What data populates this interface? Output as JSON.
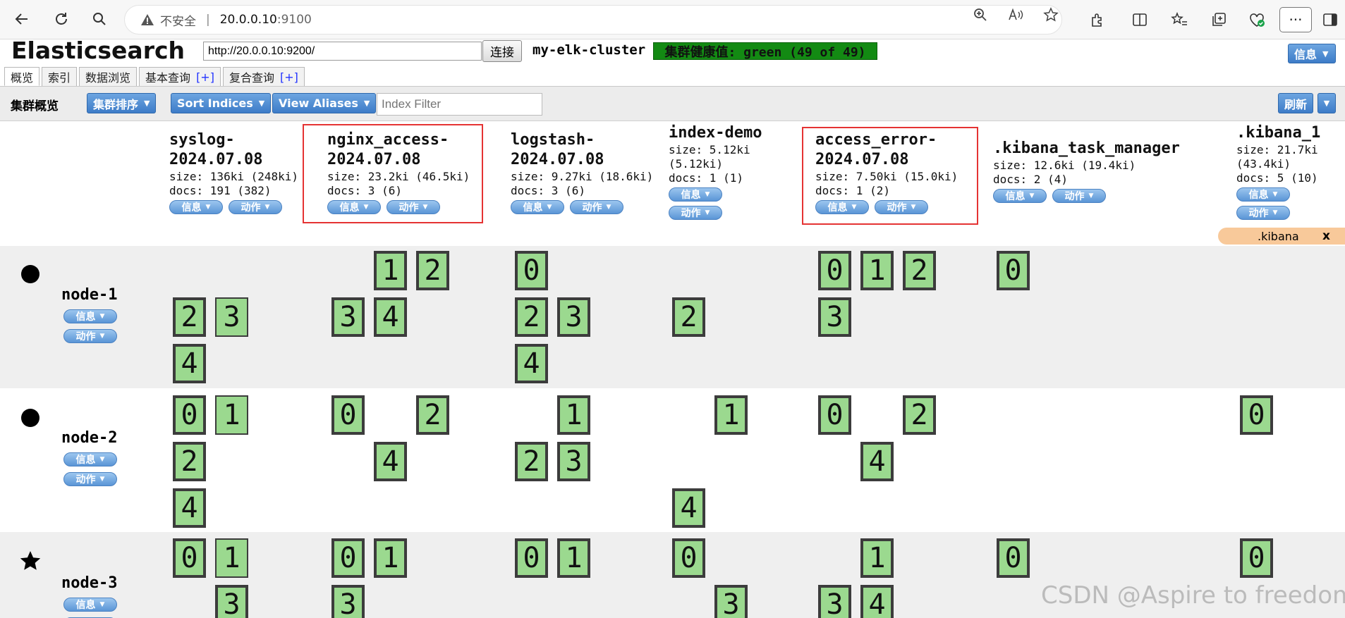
{
  "browser": {
    "insecure_label": "不安全",
    "address_sep": "|",
    "url_host": "20.0.0.10",
    "url_port": ":9100"
  },
  "app": {
    "title": "Elasticsearch",
    "connection_url": "http://20.0.0.10:9200/",
    "connect_label": "连接",
    "cluster_name": "my-elk-cluster",
    "health": "集群健康值: green (49 of 49)",
    "health_color": "#138a13",
    "info_label": "信息"
  },
  "tabs": [
    {
      "label": "概览",
      "plus": ""
    },
    {
      "label": "索引",
      "plus": ""
    },
    {
      "label": "数据浏览",
      "plus": ""
    },
    {
      "label": "基本查询",
      "plus": "[+]"
    },
    {
      "label": "复合查询",
      "plus": "[+]"
    }
  ],
  "toolbar": {
    "title": "集群概览",
    "sort_cluster": "集群排序",
    "sort_indices": "Sort Indices",
    "view_aliases": "View Aliases",
    "index_filter_placeholder": "Index Filter",
    "refresh": "刷新"
  },
  "pill_labels": {
    "info": "信息",
    "action": "动作"
  },
  "indices": [
    {
      "name": "syslog-\n2024.07.08",
      "meta": [
        "size: 136ki (248ki)",
        "docs: 191 (382)"
      ],
      "highlighted": false
    },
    {
      "name": "nginx_access-\n2024.07.08",
      "meta": [
        "size: 23.2ki (46.5ki)",
        "docs: 3 (6)"
      ],
      "highlighted": true
    },
    {
      "name": "logstash-\n2024.07.08",
      "meta": [
        "size: 9.27ki (18.6ki)",
        "docs: 3 (6)"
      ],
      "highlighted": false
    },
    {
      "name": "index-demo",
      "meta": [
        "size: 5.12ki",
        "(5.12ki)",
        "docs: 1 (1)"
      ],
      "highlighted": false
    },
    {
      "name": "access_error-\n2024.07.08",
      "meta": [
        "size: 7.50ki (15.0ki)",
        "docs: 1 (2)"
      ],
      "highlighted": true
    },
    {
      "name": ".kibana_task_manager",
      "meta": [
        "size: 12.6ki (19.4ki)",
        "docs: 2 (4)"
      ],
      "highlighted": false
    },
    {
      "name": ".kibana_1",
      "meta": [
        "size: 21.7ki",
        "(43.4ki)",
        "docs: 5 (10)"
      ],
      "highlighted": false
    }
  ],
  "alias": {
    "name": ".kibana",
    "close": "x"
  },
  "nodes": [
    {
      "name": "node-1",
      "icon": "circle-icon"
    },
    {
      "name": "node-2",
      "icon": "circle-icon"
    },
    {
      "name": "node-3",
      "icon": "star-icon"
    }
  ],
  "shards": {
    "node-1": {
      "nginx_access-2024.07.08": [
        "1",
        "2",
        "3",
        "4"
      ],
      "logstash-2024.07.08": [
        "0",
        "2",
        "3",
        "4"
      ],
      "syslog-2024.07.08": [
        "2",
        "3",
        "4"
      ],
      "index-demo": [
        "2"
      ],
      "access_error-2024.07.08": [
        "0",
        "1",
        "2",
        "3"
      ],
      ".kibana_task_manager": [
        "0"
      ]
    },
    "node-2": {
      "syslog-2024.07.08": [
        "0",
        "1",
        "2",
        "4"
      ],
      "nginx_access-2024.07.08": [
        "0",
        "2",
        "4"
      ],
      "logstash-2024.07.08": [
        "1",
        "2",
        "3"
      ],
      "index-demo": [
        "1",
        "4"
      ],
      "access_error-2024.07.08": [
        "0",
        "2",
        "4"
      ],
      ".kibana_1": [
        "0"
      ]
    },
    "node-3": {
      "syslog-2024.07.08": [
        "0",
        "1",
        "3"
      ],
      "nginx_access-2024.07.08": [
        "0",
        "1",
        "3"
      ],
      "logstash-2024.07.08": [
        "0",
        "1"
      ],
      "index-demo": [
        "0",
        "3"
      ],
      "access_error-2024.07.08": [
        "1",
        "3",
        "4"
      ],
      ".kibana_task_manager": [
        "0"
      ],
      ".kibana_1": [
        "0"
      ]
    }
  },
  "watermark": "CSDN @Aspire to freedom"
}
